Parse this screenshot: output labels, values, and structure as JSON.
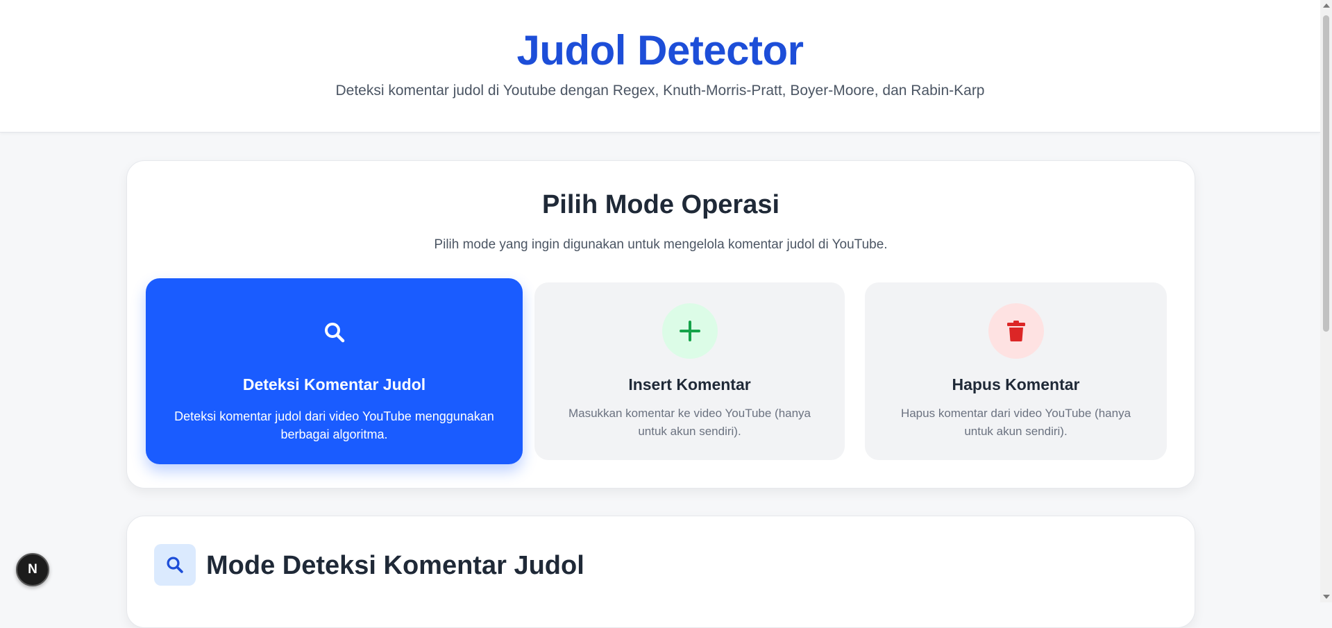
{
  "header": {
    "title": "Judol Detector",
    "subtitle": "Deteksi komentar judol di Youtube dengan Regex, Knuth-Morris-Pratt, Boyer-Moore, dan Rabin-Karp"
  },
  "mode_section": {
    "title": "Pilih Mode Operasi",
    "subtitle": "Pilih mode yang ingin digunakan untuk mengelola komentar judol di YouTube.",
    "options": [
      {
        "title": "Deteksi Komentar Judol",
        "description": "Deteksi komentar judol dari video YouTube menggunakan berbagai algoritma.",
        "icon": "search-icon",
        "selected": true
      },
      {
        "title": "Insert Komentar",
        "description": "Masukkan komentar ke video YouTube (hanya untuk akun sendiri).",
        "icon": "plus-icon",
        "selected": false
      },
      {
        "title": "Hapus Komentar",
        "description": "Hapus komentar dari video YouTube (hanya untuk akun sendiri).",
        "icon": "trash-icon",
        "selected": false
      }
    ]
  },
  "detect_section": {
    "title": "Mode Deteksi Komentar Judol",
    "icon": "search-icon"
  },
  "dev_badge": {
    "label": "N",
    "icon": "nextjs-icon"
  },
  "colors": {
    "primary": "#1d4ed8",
    "active_card": "#1a5cff",
    "insert_green": "#16a34a",
    "delete_red": "#dc2626",
    "background": "#f6f7f9"
  }
}
